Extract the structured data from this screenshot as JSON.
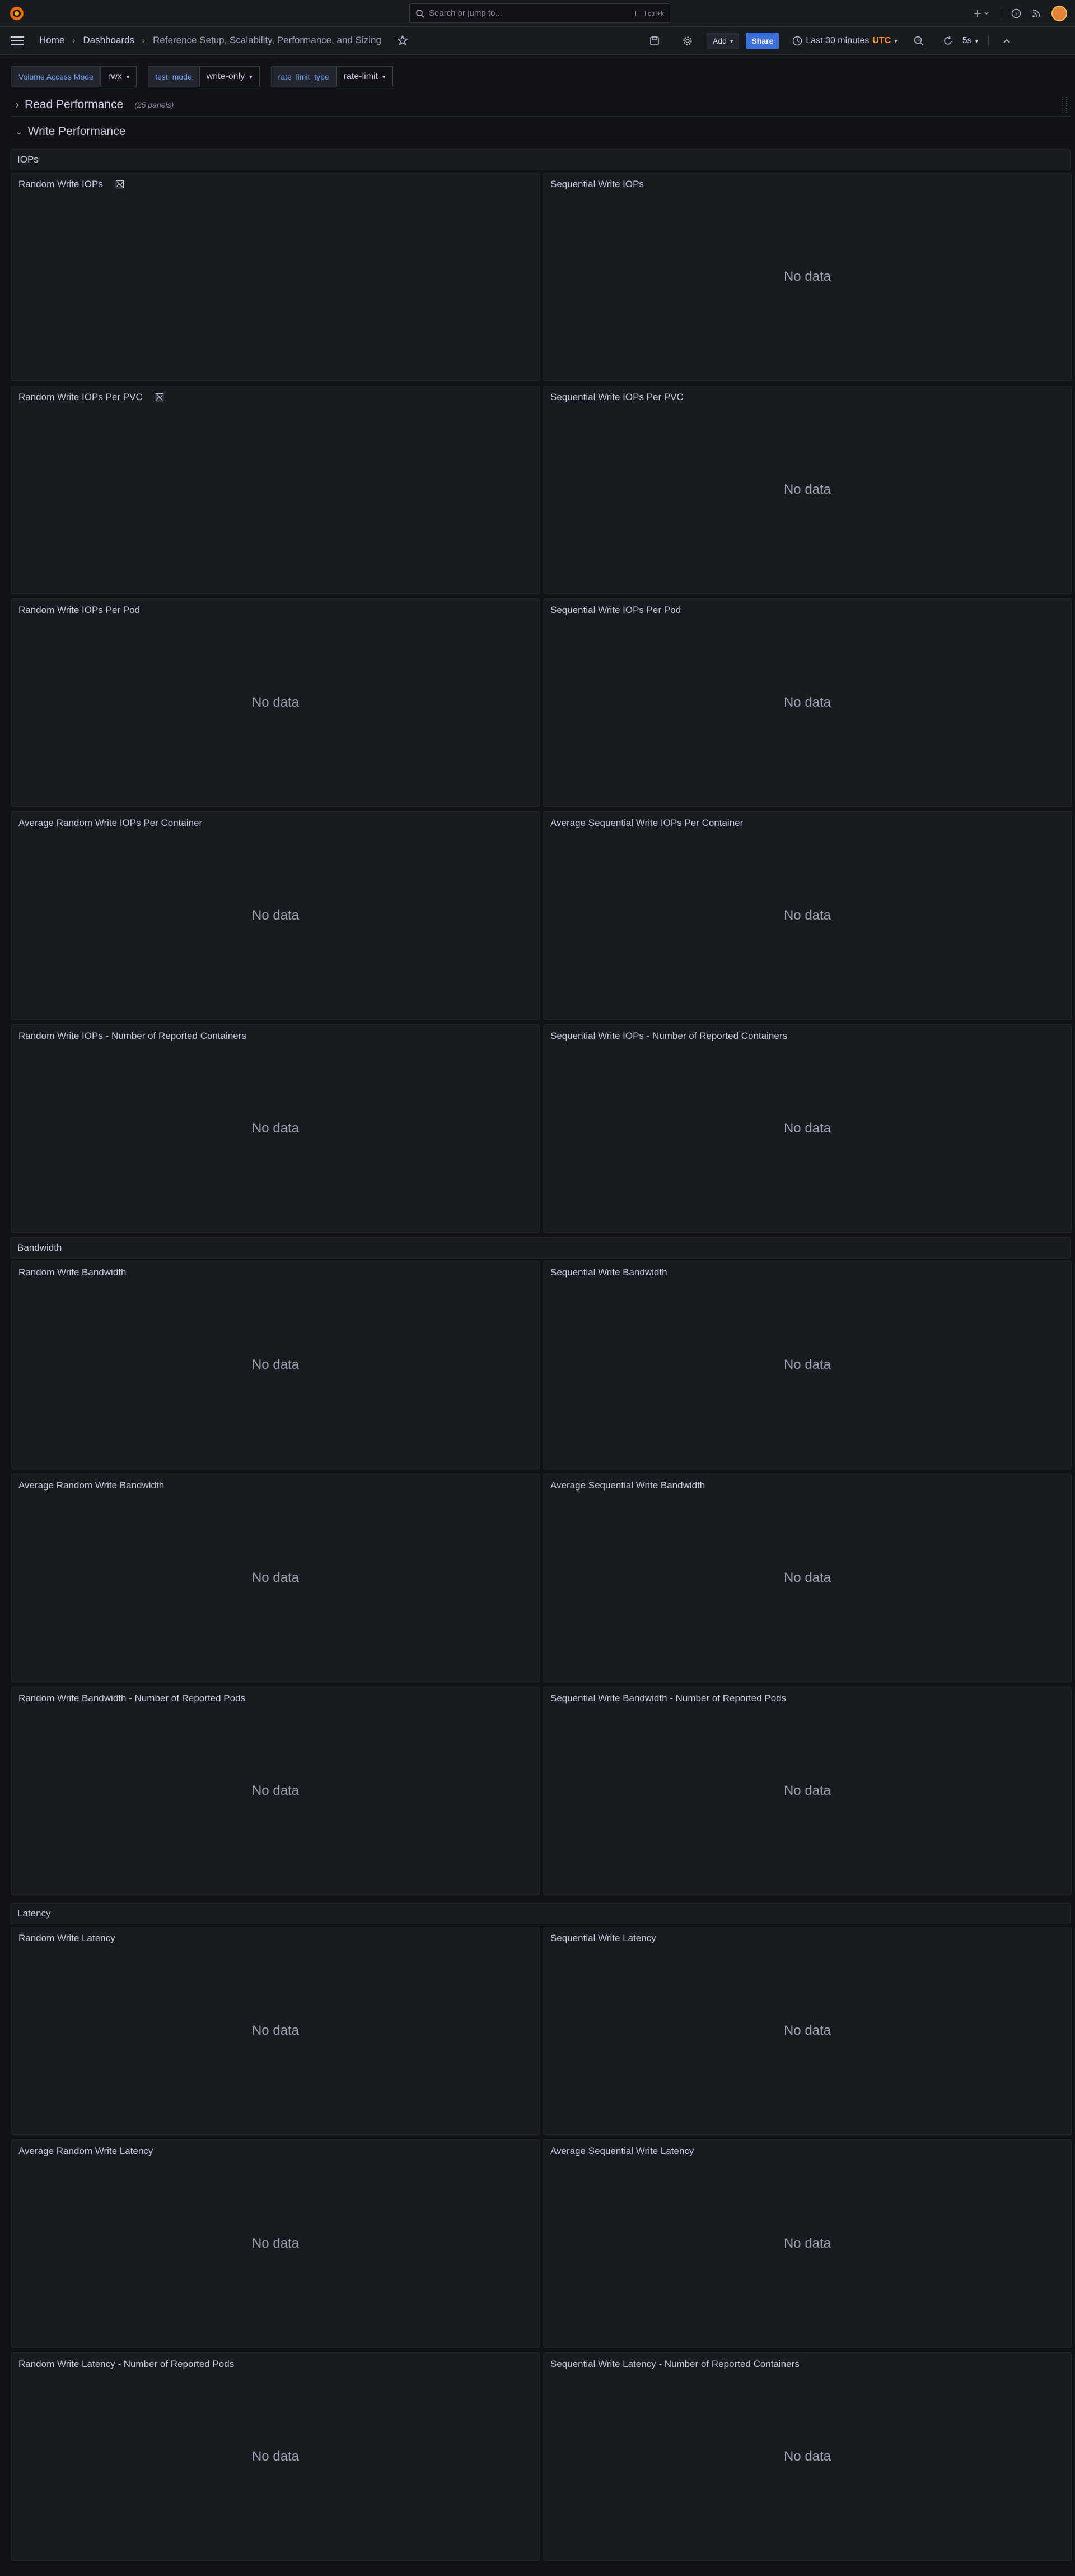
{
  "topbar": {
    "search_placeholder": "Search or jump to...",
    "search_shortcut": "ctrl+k"
  },
  "nav": {
    "breadcrumbs": [
      "Home",
      "Dashboards",
      "Reference Setup, Scalability, Performance, and Sizing"
    ],
    "add_label": "Add",
    "share_label": "Share",
    "time_range": "Last 30 minutes",
    "timezone": "UTC",
    "refresh_interval": "5s"
  },
  "variables": [
    {
      "label": "Volume Access Mode",
      "value": "rwx"
    },
    {
      "label": "test_mode",
      "value": "write-only"
    },
    {
      "label": "rate_limit_type",
      "value": "rate-limit"
    }
  ],
  "rows": {
    "read": {
      "title": "Read Performance",
      "count": "(25 panels)"
    },
    "write": {
      "title": "Write Performance"
    }
  },
  "sections": {
    "iops": "IOPs",
    "bandwidth": "Bandwidth",
    "latency": "Latency"
  },
  "no_data": "No data",
  "panels": {
    "iops": [
      {
        "title": "Random Write IOPs",
        "nodata": false,
        "icon": true
      },
      {
        "title": "Sequential Write IOPs",
        "nodata": true,
        "icon": false
      },
      {
        "title": "Random Write IOPs Per PVC",
        "nodata": false,
        "icon": true
      },
      {
        "title": "Sequential Write IOPs Per PVC",
        "nodata": true,
        "icon": false
      },
      {
        "title": "Random Write IOPs Per Pod",
        "nodata": true,
        "icon": false
      },
      {
        "title": "Sequential Write IOPs Per Pod",
        "nodata": true,
        "icon": false
      },
      {
        "title": "Average Random Write IOPs Per Container",
        "nodata": true,
        "icon": false
      },
      {
        "title": "Average Sequential Write IOPs Per Container",
        "nodata": true,
        "icon": false
      },
      {
        "title": "Random Write IOPs - Number of Reported Containers",
        "nodata": true,
        "icon": false
      },
      {
        "title": "Sequential Write IOPs - Number of Reported Containers",
        "nodata": true,
        "icon": false
      }
    ],
    "bandwidth": [
      {
        "title": "Random Write Bandwidth",
        "nodata": true,
        "icon": false
      },
      {
        "title": "Sequential Write Bandwidth",
        "nodata": true,
        "icon": false
      },
      {
        "title": "Average Random Write Bandwidth",
        "nodata": true,
        "icon": false
      },
      {
        "title": "Average Sequential Write Bandwidth",
        "nodata": true,
        "icon": false
      },
      {
        "title": "Random Write Bandwidth - Number of Reported Pods",
        "nodata": true,
        "icon": false
      },
      {
        "title": "Sequential Write Bandwidth - Number of Reported Pods",
        "nodata": true,
        "icon": false
      }
    ],
    "latency": [
      {
        "title": "Random Write Latency",
        "nodata": true,
        "icon": false
      },
      {
        "title": "Sequential Write Latency",
        "nodata": true,
        "icon": false
      },
      {
        "title": "Average Random Write Latency",
        "nodata": true,
        "icon": false
      },
      {
        "title": "Average Sequential Write Latency",
        "nodata": true,
        "icon": false
      },
      {
        "title": "Random Write Latency - Number of Reported Pods",
        "nodata": true,
        "icon": false
      },
      {
        "title": "Sequential Write Latency - Number of Reported Containers",
        "nodata": true,
        "icon": false
      }
    ]
  },
  "colors": {
    "accent": "#3d71d9",
    "utc": "#ff9830",
    "variable_label": "#6e9fff"
  }
}
